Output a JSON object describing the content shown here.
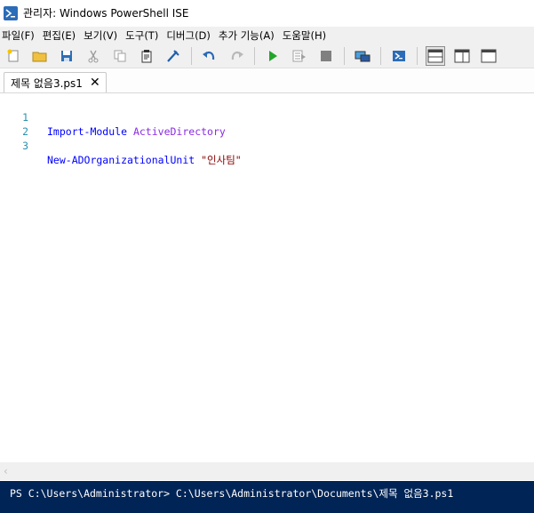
{
  "window": {
    "title": "관리자: Windows PowerShell ISE",
    "icon": "powershell-ise-icon"
  },
  "menu": {
    "items": [
      {
        "label": "파일(F)"
      },
      {
        "label": "편집(E)"
      },
      {
        "label": "보기(V)"
      },
      {
        "label": "도구(T)"
      },
      {
        "label": "디버그(D)"
      },
      {
        "label": "추가 기능(A)"
      },
      {
        "label": "도움말(H)"
      }
    ]
  },
  "toolbar": {
    "buttons": [
      "new-file-icon",
      "open-folder-icon",
      "save-icon",
      "cut-icon",
      "copy-icon",
      "paste-icon",
      "clear-console-icon",
      "undo-icon",
      "redo-icon",
      "run-script-icon",
      "run-selection-icon",
      "stop-icon",
      "new-remote-tab-icon",
      "powershell-console-icon",
      "layout-top-icon",
      "layout-right-icon",
      "layout-max-icon"
    ]
  },
  "tabs": [
    {
      "label": "제목 없음3.ps1",
      "active": true
    }
  ],
  "editor": {
    "lines": [
      {
        "num": "1",
        "tokens": [
          {
            "t": "Import-Module",
            "c": "kw"
          },
          {
            "t": " ",
            "c": ""
          },
          {
            "t": "ActiveDirectory",
            "c": "arg"
          }
        ]
      },
      {
        "num": "2",
        "tokens": []
      },
      {
        "num": "3",
        "tokens": [
          {
            "t": "New-ADOrganizationalUnit",
            "c": "kw"
          },
          {
            "t": " ",
            "c": ""
          },
          {
            "t": "\"인사팀\"",
            "c": "str"
          }
        ]
      }
    ]
  },
  "console": {
    "prompt": "PS C:\\Users\\Administrator> C:\\Users\\Administrator\\Documents\\제목 없음3.ps1"
  },
  "colors": {
    "console_bg": "#012456",
    "keyword": "#0000ff",
    "argument": "#8a2be2",
    "string": "#8b0000",
    "line_number": "#2b91af"
  }
}
